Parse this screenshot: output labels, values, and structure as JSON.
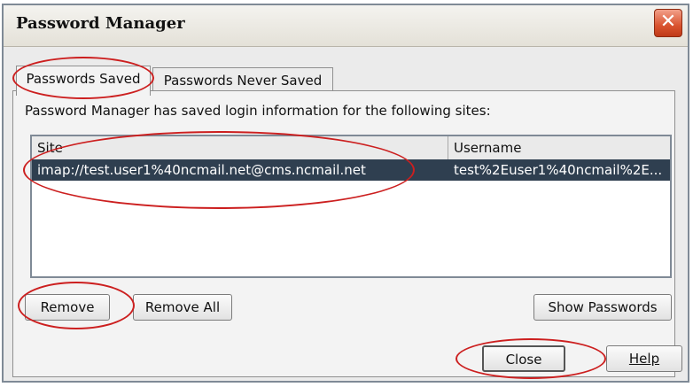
{
  "window": {
    "title": "Password Manager",
    "close_glyph": "✕"
  },
  "tabs": [
    {
      "label": "Passwords Saved",
      "active": true
    },
    {
      "label": "Passwords Never Saved",
      "active": false
    }
  ],
  "description": "Password Manager has saved login information for the following sites:",
  "list": {
    "columns": [
      "Site",
      "Username"
    ],
    "rows": [
      {
        "site": "imap://test.user1%40ncmail.net@cms.ncmail.net",
        "username": "test%2Euser1%40ncmail%2E..."
      }
    ]
  },
  "buttons": {
    "remove": "Remove",
    "remove_all": "Remove All",
    "show_passwords": "Show Passwords",
    "close": "Close",
    "help": "Help"
  },
  "colors": {
    "selection": "#2f3f50",
    "annotation": "#cc1f1f",
    "close_button": "#d9532f"
  }
}
